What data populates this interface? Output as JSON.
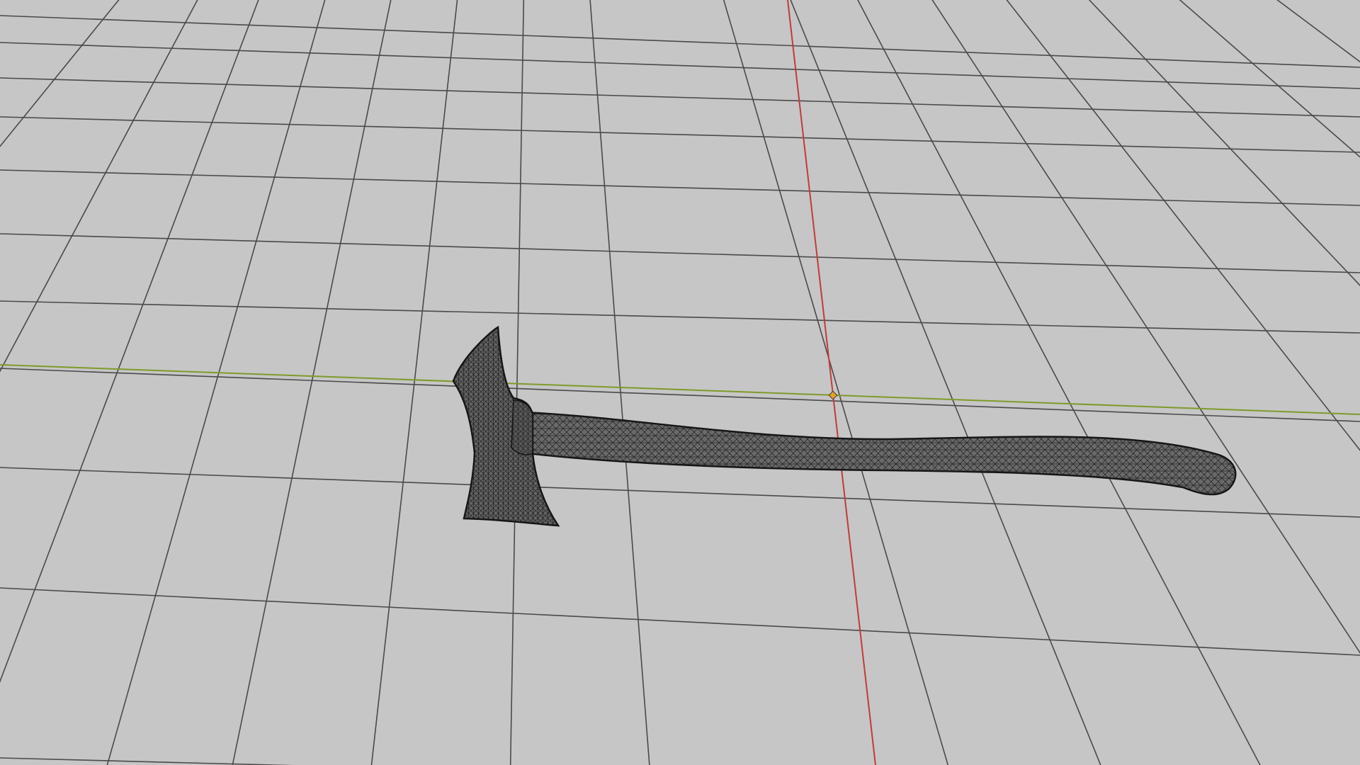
{
  "viewport": {
    "background_color": "#c6c6c6",
    "grid_line_color": "#4a4a4a",
    "x_axis_color": "#7f9a2a",
    "y_axis_color": "#c43a3a",
    "origin_marker_color": "#e8a020",
    "mesh_fill_color": "#6a6a6a",
    "mesh_wire_color": "#1e1e1e",
    "shading_mode": "wireframe-overlay",
    "object": "axe-mesh"
  }
}
